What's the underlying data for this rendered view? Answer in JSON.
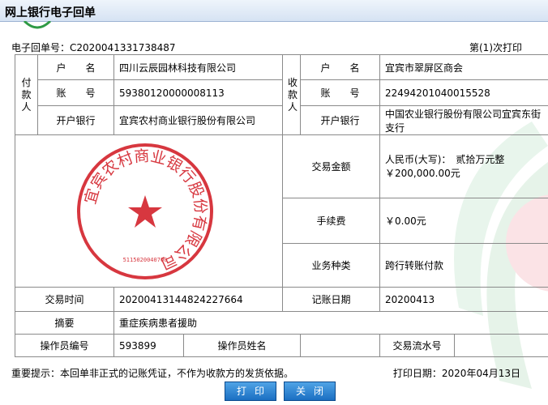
{
  "window": {
    "title": "网上银行电子回单"
  },
  "header": {
    "receipt_no": "电子回单号：C2020041331738487",
    "print_count": "第(1)次打印"
  },
  "payer": {
    "section_label": "付款人",
    "name_label": "户　　名",
    "name": "四川云辰园林科技有限公司",
    "account_label": "账　　号",
    "account": "59380120000008113",
    "bank_label": "开户银行",
    "bank": "宜宾农村商业银行股份有限公司"
  },
  "payee": {
    "section_label": "收款人",
    "name_label": "户　　名",
    "name": "宜宾市翠屏区商会",
    "account_label": "账　　号",
    "account": "22494201040015528",
    "bank_label": "开户银行",
    "bank": "中国农业银行股份有限公司宜宾东街支行"
  },
  "transaction": {
    "amount_label": "交易金额",
    "amount_words": "人民币(大写)：　贰拾万元整",
    "amount": "￥200,000.00元",
    "fee_label": "手续费",
    "fee": "￥0.00元",
    "type_label": "业务种类",
    "type": "跨行转账付款",
    "time_label": "交易时间",
    "time": "20200413144824227664",
    "post_date_label": "记账日期",
    "post_date": "20200413",
    "memo_label": "摘要",
    "memo": "重症疾病患者援助",
    "operator_id_label": "操作员编号",
    "operator_id": "593899",
    "operator_name_label": "操作员姓名",
    "operator_name": "",
    "serial_label": "交易流水号",
    "serial": ""
  },
  "seal": {
    "text": "宜宾农村商业银行股份有限公司",
    "number": "5115020040700",
    "color": "#d7373f"
  },
  "footer": {
    "notice": "重要提示：本回单非正式的记账凭证，不作为收款方的发货依据。",
    "print_date": "打印日期：2020年04月13日"
  },
  "buttons": {
    "print": "打印",
    "close": "关闭"
  }
}
